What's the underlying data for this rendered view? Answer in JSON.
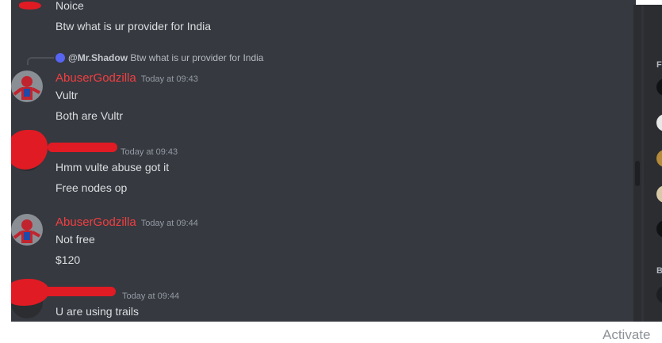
{
  "messages": {
    "m0": {
      "text": "Noice"
    },
    "m1": {
      "text": "Btw what is ur provider for India"
    },
    "reply": {
      "user": "@Mr.Shadow",
      "text": "Btw what is ur provider for India"
    },
    "m2": {
      "author": "AbuserGodzilla",
      "time": "Today at 09:43",
      "lines": [
        "Vultr",
        "Both are Vultr"
      ]
    },
    "m3": {
      "time": "Today at 09:43",
      "lines": [
        "Hmm vulte abuse got it",
        "Free nodes op"
      ]
    },
    "m4": {
      "author": "AbuserGodzilla",
      "time": "Today at 09:44",
      "lines": [
        "Not free",
        "$120"
      ]
    },
    "m5": {
      "time": "Today at 09:44",
      "lines": [
        "U are using trails"
      ]
    }
  },
  "members": {
    "section1": "F",
    "section2": "B"
  },
  "watermark": "Activate",
  "colors": {
    "author": "#f23f42",
    "redaction": "#e01b24",
    "background": "#36393f"
  }
}
